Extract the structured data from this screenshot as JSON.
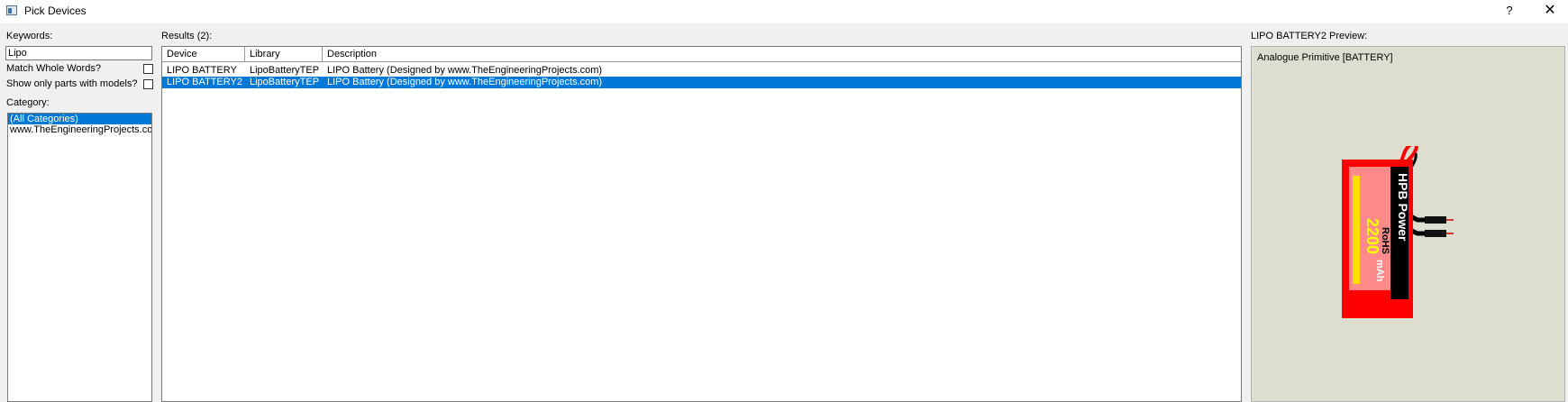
{
  "window": {
    "title": "Pick Devices",
    "help_label": "?",
    "close_label": "✕"
  },
  "filters": {
    "keywords_label": "Keywords:",
    "keywords_value": "Lipo",
    "match_whole_words_label": "Match Whole Words?",
    "match_whole_words_checked": false,
    "only_models_label": "Show only parts with models?",
    "only_models_checked": false,
    "category_label": "Category:",
    "categories": [
      {
        "label": "(All Categories)",
        "selected": true
      },
      {
        "label": "www.TheEngineeringProjects.com",
        "selected": false
      }
    ]
  },
  "results": {
    "label": "Results (2):",
    "columns": [
      "Device",
      "Library",
      "Description"
    ],
    "rows": [
      {
        "device": "LIPO BATTERY",
        "library": "LipoBatteryTEP",
        "description": "LIPO Battery (Designed by www.TheEngineeringProjects.com)",
        "selected": false
      },
      {
        "device": "LIPO BATTERY2",
        "library": "LipoBatteryTEP",
        "description": "LIPO Battery (Designed by www.TheEngineeringProjects.com)",
        "selected": true
      }
    ]
  },
  "preview": {
    "label": "LIPO BATTERY2 Preview:",
    "subtitle": "Analogue Primitive [BATTERY]",
    "image": {
      "brand_text": "HPB  Power",
      "capacity_text": "2200",
      "unit_text": "mAh",
      "rohs_text": "RoHS"
    }
  },
  "colors": {
    "selection": "#0078d7",
    "preview_bg": "#deded0",
    "battery_red": "#ff0000",
    "battery_pink": "#ff8a8a"
  }
}
